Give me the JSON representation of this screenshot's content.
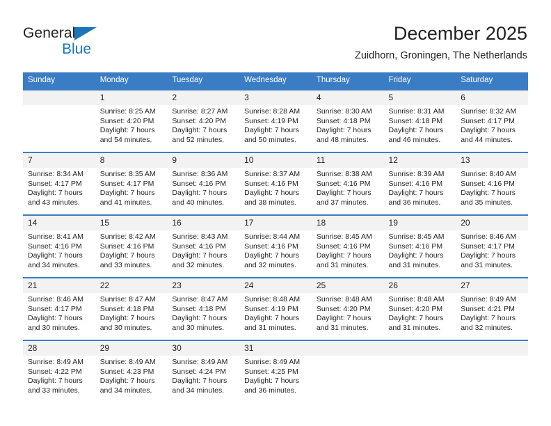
{
  "brand": {
    "name_part1": "General",
    "name_part2": "Blue",
    "triangle_icon": "triangle-icon",
    "color_dark": "#231f20",
    "color_blue": "#1b75bb"
  },
  "header": {
    "title": "December 2025",
    "subtitle": "Zuidhorn, Groningen, The Netherlands",
    "accent_color": "#3b7dc4",
    "daynum_bg": "#f2f2f2"
  },
  "weekday_headers": [
    "Sunday",
    "Monday",
    "Tuesday",
    "Wednesday",
    "Thursday",
    "Friday",
    "Saturday"
  ],
  "weeks": [
    [
      {
        "day": "",
        "sunrise": "",
        "sunset": "",
        "daylight": ""
      },
      {
        "day": "1",
        "sunrise": "Sunrise: 8:25 AM",
        "sunset": "Sunset: 4:20 PM",
        "daylight": "Daylight: 7 hours and 54 minutes."
      },
      {
        "day": "2",
        "sunrise": "Sunrise: 8:27 AM",
        "sunset": "Sunset: 4:20 PM",
        "daylight": "Daylight: 7 hours and 52 minutes."
      },
      {
        "day": "3",
        "sunrise": "Sunrise: 8:28 AM",
        "sunset": "Sunset: 4:19 PM",
        "daylight": "Daylight: 7 hours and 50 minutes."
      },
      {
        "day": "4",
        "sunrise": "Sunrise: 8:30 AM",
        "sunset": "Sunset: 4:18 PM",
        "daylight": "Daylight: 7 hours and 48 minutes."
      },
      {
        "day": "5",
        "sunrise": "Sunrise: 8:31 AM",
        "sunset": "Sunset: 4:18 PM",
        "daylight": "Daylight: 7 hours and 46 minutes."
      },
      {
        "day": "6",
        "sunrise": "Sunrise: 8:32 AM",
        "sunset": "Sunset: 4:17 PM",
        "daylight": "Daylight: 7 hours and 44 minutes."
      }
    ],
    [
      {
        "day": "7",
        "sunrise": "Sunrise: 8:34 AM",
        "sunset": "Sunset: 4:17 PM",
        "daylight": "Daylight: 7 hours and 43 minutes."
      },
      {
        "day": "8",
        "sunrise": "Sunrise: 8:35 AM",
        "sunset": "Sunset: 4:17 PM",
        "daylight": "Daylight: 7 hours and 41 minutes."
      },
      {
        "day": "9",
        "sunrise": "Sunrise: 8:36 AM",
        "sunset": "Sunset: 4:16 PM",
        "daylight": "Daylight: 7 hours and 40 minutes."
      },
      {
        "day": "10",
        "sunrise": "Sunrise: 8:37 AM",
        "sunset": "Sunset: 4:16 PM",
        "daylight": "Daylight: 7 hours and 38 minutes."
      },
      {
        "day": "11",
        "sunrise": "Sunrise: 8:38 AM",
        "sunset": "Sunset: 4:16 PM",
        "daylight": "Daylight: 7 hours and 37 minutes."
      },
      {
        "day": "12",
        "sunrise": "Sunrise: 8:39 AM",
        "sunset": "Sunset: 4:16 PM",
        "daylight": "Daylight: 7 hours and 36 minutes."
      },
      {
        "day": "13",
        "sunrise": "Sunrise: 8:40 AM",
        "sunset": "Sunset: 4:16 PM",
        "daylight": "Daylight: 7 hours and 35 minutes."
      }
    ],
    [
      {
        "day": "14",
        "sunrise": "Sunrise: 8:41 AM",
        "sunset": "Sunset: 4:16 PM",
        "daylight": "Daylight: 7 hours and 34 minutes."
      },
      {
        "day": "15",
        "sunrise": "Sunrise: 8:42 AM",
        "sunset": "Sunset: 4:16 PM",
        "daylight": "Daylight: 7 hours and 33 minutes."
      },
      {
        "day": "16",
        "sunrise": "Sunrise: 8:43 AM",
        "sunset": "Sunset: 4:16 PM",
        "daylight": "Daylight: 7 hours and 32 minutes."
      },
      {
        "day": "17",
        "sunrise": "Sunrise: 8:44 AM",
        "sunset": "Sunset: 4:16 PM",
        "daylight": "Daylight: 7 hours and 32 minutes."
      },
      {
        "day": "18",
        "sunrise": "Sunrise: 8:45 AM",
        "sunset": "Sunset: 4:16 PM",
        "daylight": "Daylight: 7 hours and 31 minutes."
      },
      {
        "day": "19",
        "sunrise": "Sunrise: 8:45 AM",
        "sunset": "Sunset: 4:16 PM",
        "daylight": "Daylight: 7 hours and 31 minutes."
      },
      {
        "day": "20",
        "sunrise": "Sunrise: 8:46 AM",
        "sunset": "Sunset: 4:17 PM",
        "daylight": "Daylight: 7 hours and 31 minutes."
      }
    ],
    [
      {
        "day": "21",
        "sunrise": "Sunrise: 8:46 AM",
        "sunset": "Sunset: 4:17 PM",
        "daylight": "Daylight: 7 hours and 30 minutes."
      },
      {
        "day": "22",
        "sunrise": "Sunrise: 8:47 AM",
        "sunset": "Sunset: 4:18 PM",
        "daylight": "Daylight: 7 hours and 30 minutes."
      },
      {
        "day": "23",
        "sunrise": "Sunrise: 8:47 AM",
        "sunset": "Sunset: 4:18 PM",
        "daylight": "Daylight: 7 hours and 30 minutes."
      },
      {
        "day": "24",
        "sunrise": "Sunrise: 8:48 AM",
        "sunset": "Sunset: 4:19 PM",
        "daylight": "Daylight: 7 hours and 31 minutes."
      },
      {
        "day": "25",
        "sunrise": "Sunrise: 8:48 AM",
        "sunset": "Sunset: 4:20 PM",
        "daylight": "Daylight: 7 hours and 31 minutes."
      },
      {
        "day": "26",
        "sunrise": "Sunrise: 8:48 AM",
        "sunset": "Sunset: 4:20 PM",
        "daylight": "Daylight: 7 hours and 31 minutes."
      },
      {
        "day": "27",
        "sunrise": "Sunrise: 8:49 AM",
        "sunset": "Sunset: 4:21 PM",
        "daylight": "Daylight: 7 hours and 32 minutes."
      }
    ],
    [
      {
        "day": "28",
        "sunrise": "Sunrise: 8:49 AM",
        "sunset": "Sunset: 4:22 PM",
        "daylight": "Daylight: 7 hours and 33 minutes."
      },
      {
        "day": "29",
        "sunrise": "Sunrise: 8:49 AM",
        "sunset": "Sunset: 4:23 PM",
        "daylight": "Daylight: 7 hours and 34 minutes."
      },
      {
        "day": "30",
        "sunrise": "Sunrise: 8:49 AM",
        "sunset": "Sunset: 4:24 PM",
        "daylight": "Daylight: 7 hours and 34 minutes."
      },
      {
        "day": "31",
        "sunrise": "Sunrise: 8:49 AM",
        "sunset": "Sunset: 4:25 PM",
        "daylight": "Daylight: 7 hours and 36 minutes."
      },
      {
        "day": "",
        "sunrise": "",
        "sunset": "",
        "daylight": ""
      },
      {
        "day": "",
        "sunrise": "",
        "sunset": "",
        "daylight": ""
      },
      {
        "day": "",
        "sunrise": "",
        "sunset": "",
        "daylight": ""
      }
    ]
  ]
}
